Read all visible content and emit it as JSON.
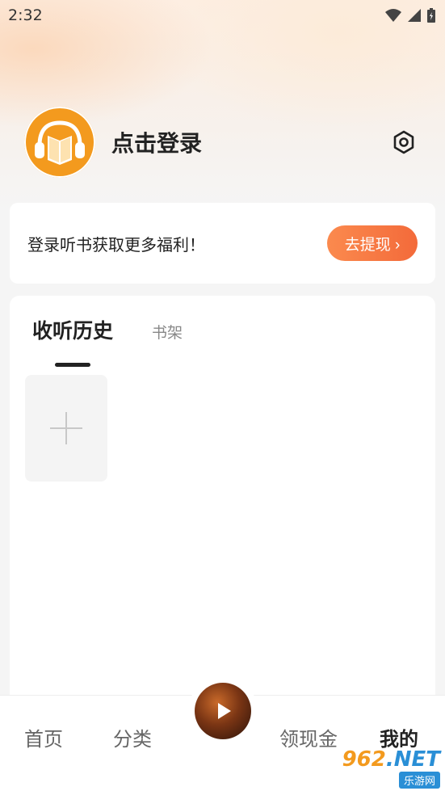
{
  "status_bar": {
    "time": "2:32"
  },
  "profile": {
    "login_label": "点击登录"
  },
  "promo": {
    "text": "登录听书获取更多福利！",
    "button_label": "去提现 ›"
  },
  "history": {
    "tabs": [
      {
        "label": "收听历史",
        "active": true
      },
      {
        "label": "书架",
        "active": false
      }
    ],
    "add_symbol": "+"
  },
  "bottom_nav": {
    "items": [
      {
        "label": "首页",
        "active": false
      },
      {
        "label": "分类",
        "active": false
      },
      {
        "label": "领现金",
        "active": false
      },
      {
        "label": "我的",
        "active": true
      }
    ]
  },
  "watermark": {
    "main": "962",
    "main_suffix": ".NET",
    "sub": "乐游网"
  },
  "colors": {
    "accent": "#f36a3a",
    "avatar": "#f39a1e"
  }
}
